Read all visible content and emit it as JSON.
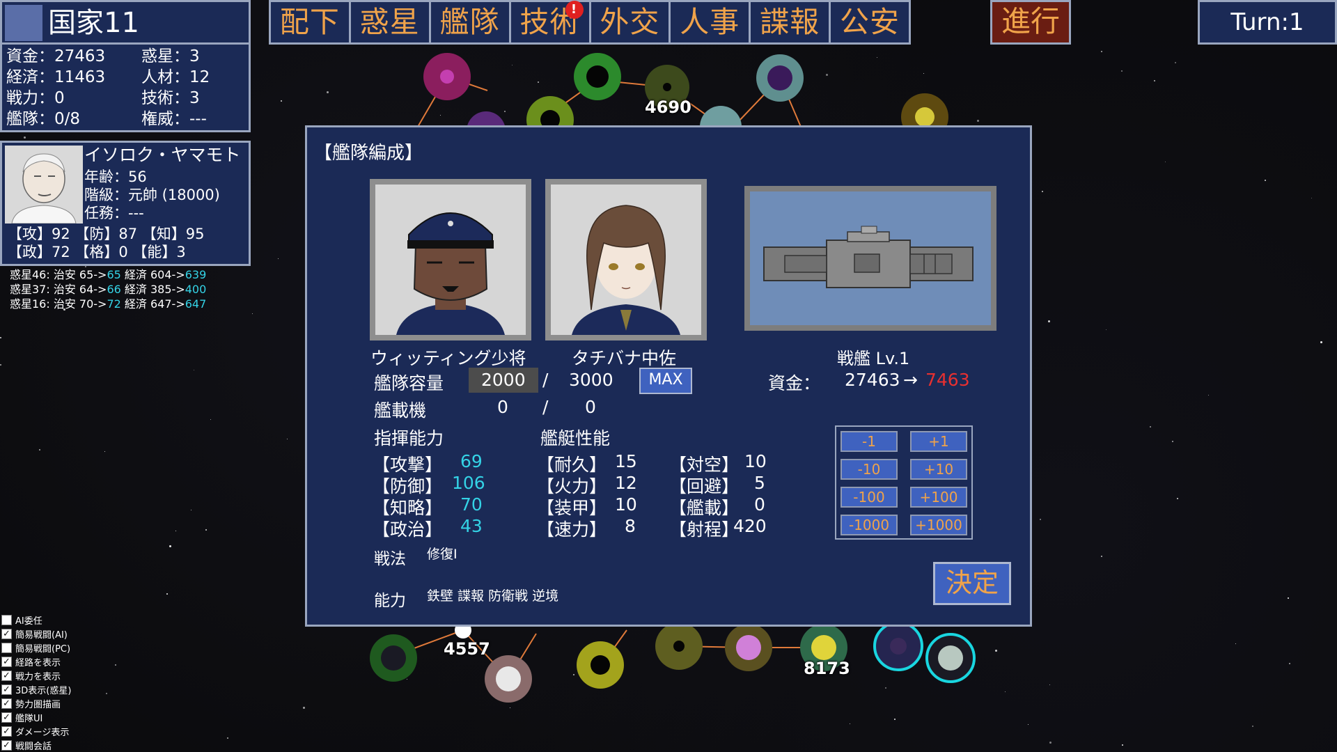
{
  "nation": {
    "name": "国家11",
    "stats": [
      {
        "label": "資金：27463"
      },
      {
        "label": "惑星：3"
      },
      {
        "label": "経済：11463"
      },
      {
        "label": "人材：12"
      },
      {
        "label": "戦力：0"
      },
      {
        "label": "技術：3"
      },
      {
        "label": "艦隊：0/8"
      },
      {
        "label": "権威：---"
      }
    ]
  },
  "commander": {
    "name": "イソロク・ヤマモト",
    "age": "年齢：56",
    "rank": "階級：元帥 (18000)",
    "duty": "任務：---",
    "stats_row1": "【攻】92 【防】87 【知】95",
    "stats_row2": "【政】72 【格】0 【能】3"
  },
  "event_log": [
    {
      "prefix": "惑星46: 治安 65->",
      "v1": "65",
      "mid": " 経済 604->",
      "v2": "639"
    },
    {
      "prefix": "惑星37: 治安 64->",
      "v1": "66",
      "mid": " 経済 385->",
      "v2": "400"
    },
    {
      "prefix": "惑星16: 治安 70->",
      "v1": "72",
      "mid": " 経済 647->",
      "v2": "647"
    }
  ],
  "menu": {
    "items": [
      "配下",
      "惑星",
      "艦隊",
      "技術",
      "外交",
      "人事",
      "諜報",
      "公安"
    ],
    "alert_badge": "!",
    "advance_label": "進行",
    "turn_label": "Turn:1"
  },
  "map_numbers": [
    "4690",
    "4557",
    "8173"
  ],
  "options": [
    {
      "label": "AI委任",
      "checked": false
    },
    {
      "label": "簡易戦闘(AI)",
      "checked": true
    },
    {
      "label": "簡易戦闘(PC)",
      "checked": false
    },
    {
      "label": "経路を表示",
      "checked": true
    },
    {
      "label": "戦力を表示",
      "checked": true
    },
    {
      "label": "3D表示(惑星)",
      "checked": true
    },
    {
      "label": "勢力圏描画",
      "checked": true
    },
    {
      "label": "艦隊UI",
      "checked": true
    },
    {
      "label": "ダメージ表示",
      "checked": true
    },
    {
      "label": "戦闘会話",
      "checked": true
    }
  ],
  "dialog": {
    "title": "【艦隊編成】",
    "officer1_name": "ウィッティング少将",
    "officer2_name": "タチバナ中佐",
    "ship_name": "戦艦 Lv.1",
    "funds_label": "資金：",
    "funds_before": "27463",
    "funds_arrow": "→",
    "funds_after": "7463",
    "capacity_label": "艦隊容量",
    "capacity_value": "2000",
    "capacity_slash": "/",
    "capacity_max": "3000",
    "max_button": "MAX",
    "aircraft_label": "艦載機",
    "aircraft_value": "0",
    "aircraft_slash": "/",
    "aircraft_max": "0",
    "command_header": "指揮能力",
    "ship_header": "艦艇性能",
    "command_stats": [
      {
        "label": "【攻撃】",
        "value": "69"
      },
      {
        "label": "【防御】",
        "value": "106"
      },
      {
        "label": "【知略】",
        "value": "70"
      },
      {
        "label": "【政治】",
        "value": "43"
      }
    ],
    "ship_stats_a": [
      {
        "label": "【耐久】",
        "value": "15"
      },
      {
        "label": "【火力】",
        "value": "12"
      },
      {
        "label": "【装甲】",
        "value": "10"
      },
      {
        "label": "【速力】",
        "value": "8"
      }
    ],
    "ship_stats_b": [
      {
        "label": "【対空】",
        "value": "10"
      },
      {
        "label": "【回避】",
        "value": "5"
      },
      {
        "label": "【艦載】",
        "value": "0"
      },
      {
        "label": "【射程】",
        "value": "420"
      }
    ],
    "tactic_label": "戦法",
    "tactic_value": "修復I",
    "ability_label": "能力",
    "ability_value": "鉄壁 諜報 防衛戦 逆境",
    "step_buttons": [
      "-1",
      "+1",
      "-10",
      "+10",
      "-100",
      "+100",
      "-1000",
      "+1000"
    ],
    "confirm_button": "決定"
  },
  "colors": {
    "panel_bg": "#1b2a56",
    "border": "#9aa6bf",
    "menu_text": "#f0a34a",
    "cyan_value": "#34d3e6",
    "red_value": "#e83030",
    "advance_bg": "#6a1d12",
    "button_blue": "#3f62bf"
  }
}
